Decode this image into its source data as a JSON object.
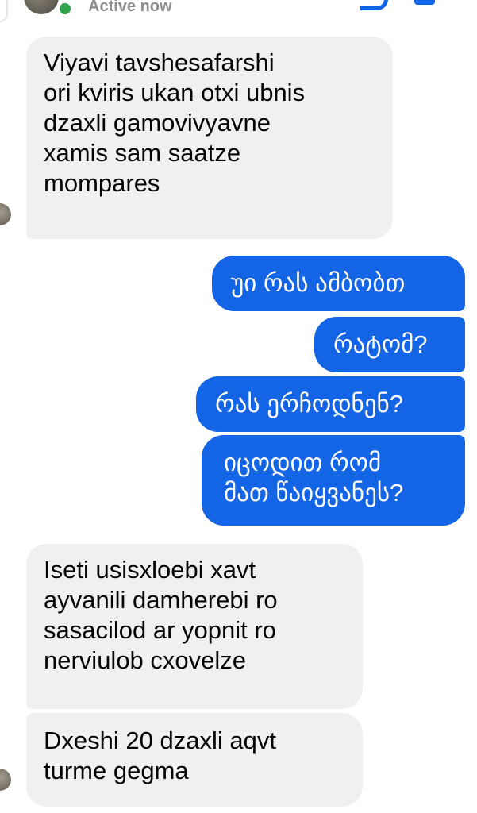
{
  "header": {
    "status": "Active now"
  },
  "colors": {
    "sent_bubble": "#1464e6",
    "received_bubble": "#f0f0f2",
    "active_dot": "#31a24c",
    "icon_blue": "#1062e6"
  },
  "messages": [
    {
      "direction": "received",
      "text": "Viyavi tavshesafarshi\nori kviris ukan otxi ubnis\ndzaxli gamovivyavne\nxamis sam saatze\nmompares"
    },
    {
      "direction": "sent",
      "text": "უი რას ამბობთ"
    },
    {
      "direction": "sent",
      "text": "რატომ?"
    },
    {
      "direction": "sent",
      "text": "რას ერჩოდნენ?"
    },
    {
      "direction": "sent",
      "text": "იცოდით რომ\nმათ წაიყვანეს?"
    },
    {
      "direction": "received",
      "text": "Iseti usisxloebi xavt\nayvanili damherebi ro\nsasacilod ar yopnit ro\nnerviulob cxovelze"
    },
    {
      "direction": "received",
      "text": "Dxeshi 20 dzaxli aqvt\nturme gegma"
    }
  ]
}
